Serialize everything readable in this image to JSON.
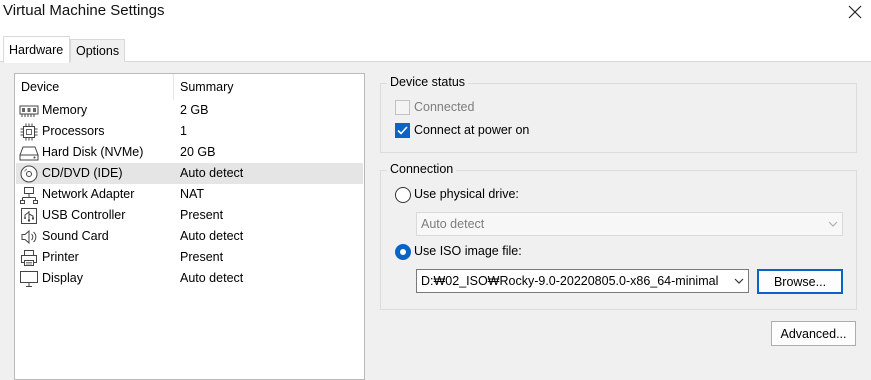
{
  "window": {
    "title": "Virtual Machine Settings"
  },
  "tabs": [
    {
      "label": "Hardware",
      "active": true
    },
    {
      "label": "Options",
      "active": false
    }
  ],
  "device_list": {
    "columns": [
      "Device",
      "Summary"
    ],
    "rows": [
      {
        "icon": "memory-icon",
        "device": "Memory",
        "summary": "2 GB",
        "selected": false
      },
      {
        "icon": "processor-icon",
        "device": "Processors",
        "summary": "1",
        "selected": false
      },
      {
        "icon": "hard-disk-icon",
        "device": "Hard Disk (NVMe)",
        "summary": "20 GB",
        "selected": false
      },
      {
        "icon": "cd-dvd-icon",
        "device": "CD/DVD (IDE)",
        "summary": "Auto detect",
        "selected": true
      },
      {
        "icon": "network-adapter-icon",
        "device": "Network Adapter",
        "summary": "NAT",
        "selected": false
      },
      {
        "icon": "usb-icon",
        "device": "USB Controller",
        "summary": "Present",
        "selected": false
      },
      {
        "icon": "sound-card-icon",
        "device": "Sound Card",
        "summary": "Auto detect",
        "selected": false
      },
      {
        "icon": "printer-icon",
        "device": "Printer",
        "summary": "Present",
        "selected": false
      },
      {
        "icon": "display-icon",
        "device": "Display",
        "summary": "Auto detect",
        "selected": false
      }
    ]
  },
  "device_status": {
    "title": "Device status",
    "connected": {
      "label": "Connected",
      "checked": false,
      "enabled": false
    },
    "connect_at_power_on": {
      "label": "Connect at power on",
      "checked": true,
      "enabled": true
    }
  },
  "connection": {
    "title": "Connection",
    "physical_drive": {
      "label": "Use physical drive:",
      "selected": false,
      "value": "Auto detect"
    },
    "iso_image": {
      "label": "Use ISO image file:",
      "selected": true,
      "value": "D:₩02_ISO₩Rocky-9.0-20220805.0-x86_64-minimal"
    },
    "browse_label": "Browse..."
  },
  "advanced_label": "Advanced...",
  "colors": {
    "accent": "#0a64c6",
    "selected_row": "#e5e5e5",
    "dialog_bg": "#f0f0f0"
  }
}
